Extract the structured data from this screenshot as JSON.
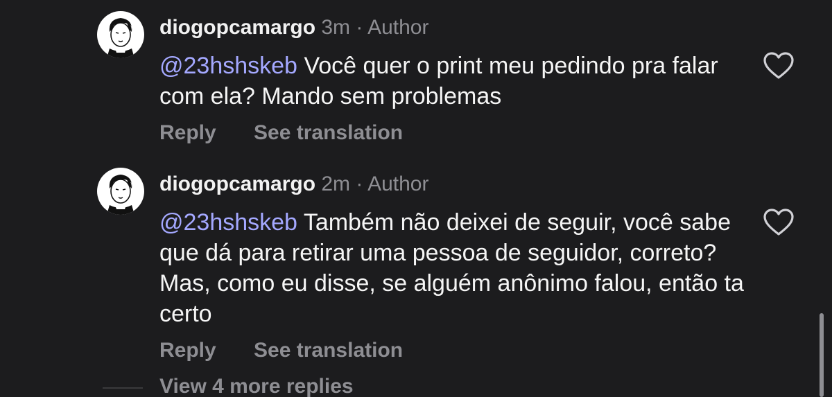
{
  "comments": [
    {
      "username": "diogopcamargo",
      "time": "3m",
      "separator": "·",
      "badge": "Author",
      "mention": "@23hshskeb",
      "text": "Você quer o print meu pedindo pra falar com ela? Mando sem problemas",
      "reply_label": "Reply",
      "translate_label": "See translation",
      "like_icon": "heart-outline-icon"
    },
    {
      "username": "diogopcamargo",
      "time": "2m",
      "separator": "·",
      "badge": "Author",
      "mention": "@23hshskeb",
      "text": "Também não deixei de seguir, você sabe que dá para retirar uma pessoa de seguidor, correto? Mas, como eu disse, se alguém anônimo falou, então ta certo",
      "reply_label": "Reply",
      "translate_label": "See translation",
      "like_icon": "heart-outline-icon"
    }
  ],
  "more_replies_label": "View 4 more replies",
  "colors": {
    "background": "#1c1c1e",
    "mention": "#a4a8ff",
    "secondary_text": "#8e8e93"
  }
}
